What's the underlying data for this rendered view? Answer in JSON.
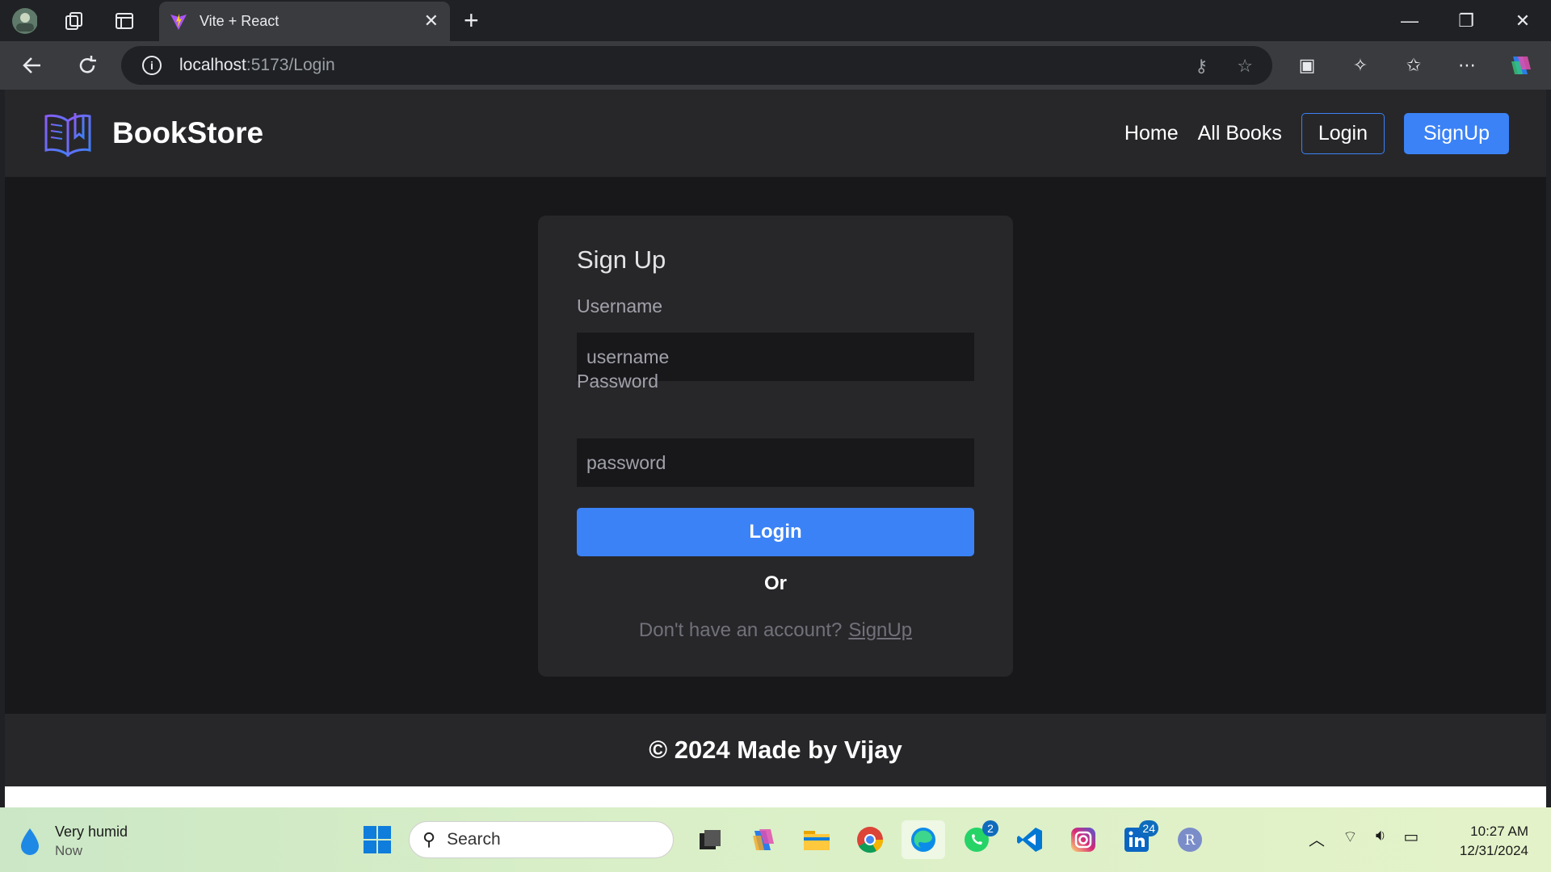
{
  "browser": {
    "tab_title": "Vite + React",
    "url_host": "localhost",
    "url_path": ":5173/Login"
  },
  "navbar": {
    "brand": "BookStore",
    "links": [
      "Home",
      "All Books"
    ],
    "login_label": "Login",
    "signup_label": "SignUp"
  },
  "form": {
    "heading": "Sign Up",
    "username_label": "Username",
    "username_placeholder": "username",
    "password_label": "Password",
    "password_placeholder": "password",
    "submit_label": "Login",
    "or_text": "Or",
    "alt_prompt": "Don't have an account?",
    "alt_link": "SignUp"
  },
  "footer": {
    "text": "© 2024 Made by Vijay"
  },
  "taskbar": {
    "weather_title": "Very humid",
    "weather_sub": "Now",
    "search_placeholder": "Search",
    "whatsapp_badge": "2",
    "linkedin_badge": "24",
    "time": "10:27 AM",
    "date": "12/31/2024"
  },
  "colors": {
    "accent": "#3b82f6",
    "page_bg": "#18181b",
    "surface": "#27272a"
  }
}
